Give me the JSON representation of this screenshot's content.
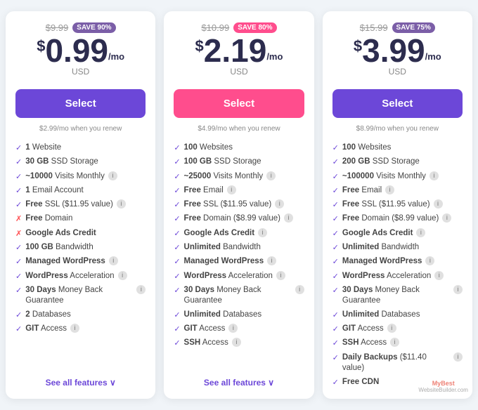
{
  "plans": [
    {
      "id": "basic",
      "original_price": "$9.99",
      "save_badge": "SAVE 90%",
      "badge_color": "purple",
      "currency": "$",
      "price": "0.99",
      "per_mo": "/mo",
      "usd": "USD",
      "select_label": "Select",
      "btn_color": "purple",
      "renew_text": "$2.99/mo when you renew",
      "features": [
        {
          "type": "check",
          "text": "1 Website",
          "bold": "1",
          "info": false
        },
        {
          "type": "check",
          "text": "30 GB SSD Storage",
          "bold": "30 GB",
          "info": false
        },
        {
          "type": "check",
          "text": "~10000 Visits Monthly",
          "bold": "~10000",
          "info": true
        },
        {
          "type": "check",
          "text": "1 Email Account",
          "bold": "1",
          "info": false
        },
        {
          "type": "check",
          "text": "Free SSL ($11.95 value)",
          "bold": "Free",
          "info": true
        },
        {
          "type": "cross",
          "text": "Free Domain",
          "bold": "Free",
          "info": false
        },
        {
          "type": "cross",
          "text": "Google Ads Credit",
          "bold": "Google Ads Credit",
          "info": false
        },
        {
          "type": "check",
          "text": "100 GB Bandwidth",
          "bold": "100 GB",
          "info": false
        },
        {
          "type": "check",
          "text": "Managed WordPress",
          "bold": "Managed WordPress",
          "info": true
        },
        {
          "type": "check",
          "text": "WordPress Acceleration",
          "bold": "WordPress",
          "info": true
        },
        {
          "type": "check",
          "text": "30 Days Money Back Guarantee",
          "bold": "30 Days",
          "info": true
        },
        {
          "type": "check",
          "text": "2 Databases",
          "bold": "2",
          "info": false
        },
        {
          "type": "check",
          "text": "GIT Access",
          "bold": "GIT",
          "info": true
        }
      ],
      "see_all": "See all features ∨"
    },
    {
      "id": "business",
      "original_price": "$10.99",
      "save_badge": "SAVE 80%",
      "badge_color": "pink",
      "currency": "$",
      "price": "2.19",
      "per_mo": "/mo",
      "usd": "USD",
      "select_label": "Select",
      "btn_color": "pink",
      "renew_text": "$4.99/mo when you renew",
      "features": [
        {
          "type": "check",
          "text": "100 Websites",
          "bold": "100",
          "info": false
        },
        {
          "type": "check",
          "text": "100 GB SSD Storage",
          "bold": "100 GB",
          "info": false
        },
        {
          "type": "check",
          "text": "~25000 Visits Monthly",
          "bold": "~25000",
          "info": true
        },
        {
          "type": "check",
          "text": "Free Email",
          "bold": "Free",
          "info": true
        },
        {
          "type": "check",
          "text": "Free SSL ($11.95 value)",
          "bold": "Free",
          "info": true
        },
        {
          "type": "check",
          "text": "Free Domain ($8.99 value)",
          "bold": "Free",
          "info": true
        },
        {
          "type": "check",
          "text": "Google Ads Credit",
          "bold": "Google Ads Credit",
          "info": true
        },
        {
          "type": "check",
          "text": "Unlimited Bandwidth",
          "bold": "Unlimited",
          "info": false
        },
        {
          "type": "check",
          "text": "Managed WordPress",
          "bold": "Managed WordPress",
          "info": true
        },
        {
          "type": "check",
          "text": "WordPress Acceleration",
          "bold": "WordPress",
          "info": true
        },
        {
          "type": "check",
          "text": "30 Days Money Back Guarantee",
          "bold": "30 Days",
          "info": true
        },
        {
          "type": "check",
          "text": "Unlimited Databases",
          "bold": "Unlimited",
          "info": false
        },
        {
          "type": "check",
          "text": "GIT Access",
          "bold": "GIT",
          "info": true
        },
        {
          "type": "check",
          "text": "SSH Access",
          "bold": "SSH",
          "info": true
        }
      ],
      "see_all": "See all features ∨"
    },
    {
      "id": "premium",
      "original_price": "$15.99",
      "save_badge": "SAVE 75%",
      "badge_color": "purple",
      "currency": "$",
      "price": "3.99",
      "per_mo": "/mo",
      "usd": "USD",
      "select_label": "Select",
      "btn_color": "purple",
      "renew_text": "$8.99/mo when you renew",
      "features": [
        {
          "type": "check",
          "text": "100 Websites",
          "bold": "100",
          "info": false
        },
        {
          "type": "check",
          "text": "200 GB SSD Storage",
          "bold": "200 GB",
          "info": false
        },
        {
          "type": "check",
          "text": "~100000 Visits Monthly",
          "bold": "~100000",
          "info": true
        },
        {
          "type": "check",
          "text": "Free Email",
          "bold": "Free",
          "info": true
        },
        {
          "type": "check",
          "text": "Free SSL ($11.95 value)",
          "bold": "Free",
          "info": true
        },
        {
          "type": "check",
          "text": "Free Domain ($8.99 value)",
          "bold": "Free",
          "info": true
        },
        {
          "type": "check",
          "text": "Google Ads Credit",
          "bold": "Google Ads Credit",
          "info": true
        },
        {
          "type": "check",
          "text": "Unlimited Bandwidth",
          "bold": "Unlimited",
          "info": false
        },
        {
          "type": "check",
          "text": "Managed WordPress",
          "bold": "Managed WordPress",
          "info": true
        },
        {
          "type": "check",
          "text": "WordPress Acceleration",
          "bold": "WordPress",
          "info": true
        },
        {
          "type": "check",
          "text": "30 Days Money Back Guarantee",
          "bold": "30 Days",
          "info": true
        },
        {
          "type": "check",
          "text": "Unlimited Databases",
          "bold": "Unlimited",
          "info": false
        },
        {
          "type": "check",
          "text": "GIT Access",
          "bold": "GIT",
          "info": true
        },
        {
          "type": "check",
          "text": "SSH Access",
          "bold": "SSH",
          "info": true
        },
        {
          "type": "check",
          "text": "Daily Backups ($11.40 value)",
          "bold": "Daily Backups",
          "info": true
        },
        {
          "type": "check",
          "text": "Free CDN",
          "bold": "Free CDN",
          "info": false
        }
      ],
      "see_all": null
    }
  ],
  "watermark": {
    "line1": "MyBest",
    "line2": "WebsiteBuilder.com"
  }
}
